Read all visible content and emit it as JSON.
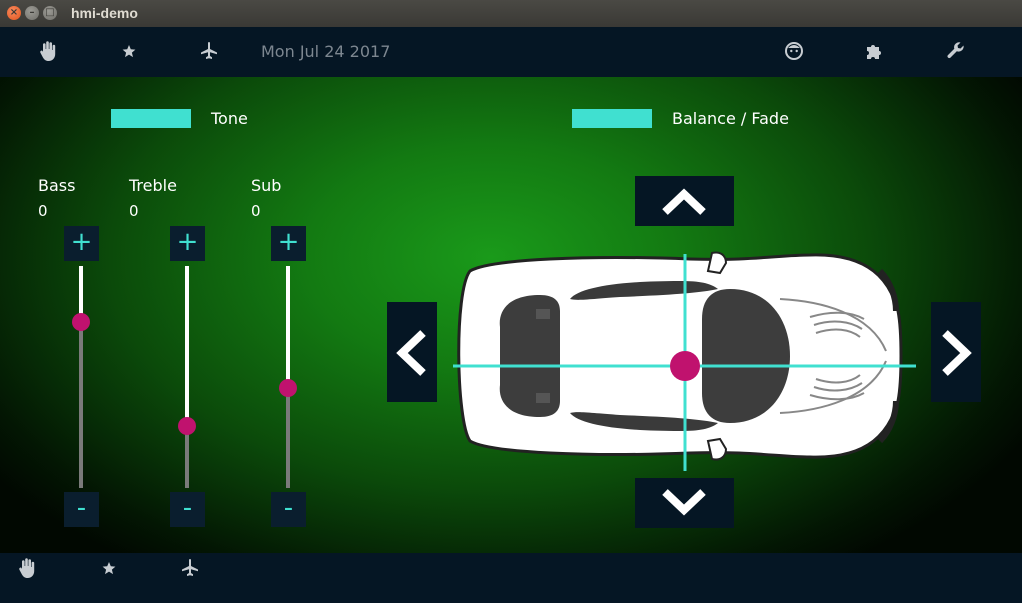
{
  "window": {
    "title": "hmi-demo",
    "close_glyph": "×",
    "minimize_glyph": "–",
    "maximize_glyph": "□"
  },
  "top_nav": {
    "items": [
      {
        "icon": "hand-icon"
      },
      {
        "icon": "star-icon"
      },
      {
        "icon": "airplane-icon"
      }
    ],
    "date": "Mon Jul 24 2017",
    "right_items": [
      {
        "icon": "face-icon"
      },
      {
        "icon": "puzzle-icon"
      },
      {
        "icon": "wrench-icon"
      }
    ]
  },
  "tone": {
    "label": "Tone",
    "swatch_color": "#40e0d0"
  },
  "balance_fade": {
    "label": "Balance / Fade",
    "swatch_color": "#40e0d0"
  },
  "sliders": [
    {
      "label": "Bass",
      "value": "0",
      "plus": "+",
      "minus": "-",
      "level": 0.75
    },
    {
      "label": "Treble",
      "value": "0",
      "plus": "+",
      "minus": "-",
      "level": 0.28
    },
    {
      "label": "Sub",
      "value": "0",
      "plus": "+",
      "minus": "-",
      "level": 0.45
    }
  ],
  "bottom_nav": {
    "items": [
      {
        "icon": "hand-icon"
      },
      {
        "icon": "star-icon"
      },
      {
        "icon": "airplane-icon"
      }
    ]
  },
  "colors": {
    "accent": "#40e0d0",
    "knob": "#c0126e",
    "bar": "#051624"
  }
}
